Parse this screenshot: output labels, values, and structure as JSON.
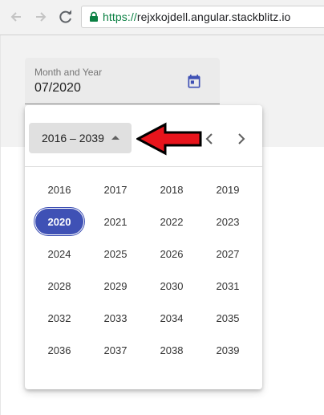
{
  "browser": {
    "back_icon": "arrow-left-icon",
    "forward_icon": "arrow-right-icon",
    "reload_icon": "reload-icon",
    "secure_icon": "lock-icon",
    "url_scheme": "https://",
    "url_host": "rejxkojdell.angular.stackblitz.io"
  },
  "field": {
    "label": "Month and Year",
    "value": "07/2020",
    "toggle_icon": "calendar-icon"
  },
  "picker": {
    "period_label": "2016 – 2039",
    "prev_icon": "chevron-left-icon",
    "next_icon": "chevron-right-icon",
    "years": [
      [
        "2016",
        "2017",
        "2018",
        "2019"
      ],
      [
        "2020",
        "2021",
        "2022",
        "2023"
      ],
      [
        "2024",
        "2025",
        "2026",
        "2027"
      ],
      [
        "2028",
        "2029",
        "2030",
        "2031"
      ],
      [
        "2032",
        "2033",
        "2034",
        "2035"
      ],
      [
        "2036",
        "2037",
        "2038",
        "2039"
      ]
    ],
    "selected_year": "2020"
  },
  "annotation": {
    "icon": "red-arrow-icon",
    "color": "#e8141c"
  },
  "colors": {
    "accent": "#3f51b5",
    "secure_green": "#0b8043"
  }
}
